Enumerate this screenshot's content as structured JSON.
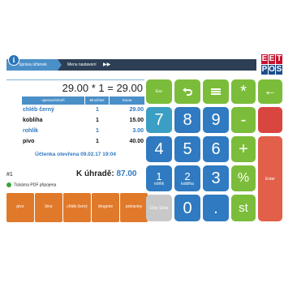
{
  "header": {
    "tab_active": "Správa účtenek",
    "tab_menu": "Menu nastavení",
    "menu_arrows": "▶▶",
    "info_icon": "i",
    "logo_top": [
      "E",
      "E",
      "T"
    ],
    "logo_bottom": [
      "P",
      "O",
      "S"
    ]
  },
  "receipt": {
    "calculation": "29.00 * 1 = 29.00",
    "columns": [
      "operace/zboží",
      "Množství",
      "Suma"
    ],
    "items": [
      {
        "name": "chléb černý",
        "qty": "1",
        "sum": "29.00"
      },
      {
        "name": "kobliha",
        "qty": "1",
        "sum": "15.00"
      },
      {
        "name": "rohlík",
        "qty": "1",
        "sum": "3.00"
      },
      {
        "name": "pivo",
        "qty": "1",
        "sum": "40.00"
      }
    ],
    "opened": "Účtenka otevřena 09.02.17 19:04",
    "number": "#1",
    "total_label": "K úhradě:",
    "total_amount": "87.00",
    "printer_status": "Tiskárna PDF připojena"
  },
  "products": [
    "pivo",
    "limo",
    "chléb černý",
    "drogerie",
    "potraviny"
  ],
  "keypad": {
    "esc": "Esc",
    "star": "*",
    "backspace": "←",
    "d7": "7",
    "d8": "8",
    "d9": "9",
    "minus": "-",
    "d4": "4",
    "d5": "5",
    "d6": "6",
    "plus": "+",
    "d1": "1",
    "d1_sub": "rohlík",
    "d2": "2",
    "d2_sub": "kobliha",
    "d3": "3",
    "percent": "%",
    "enter": "Enter",
    "tables": "Účty Stoly",
    "d0": "0",
    "dot": ".",
    "st": "st"
  },
  "colors": {
    "green": "#7bbd3a",
    "blue": "#2f7ac0",
    "teal": "#3b9ec4",
    "red": "#d9463f",
    "orange": "#e07a2a",
    "gray": "#c8c8c8"
  }
}
